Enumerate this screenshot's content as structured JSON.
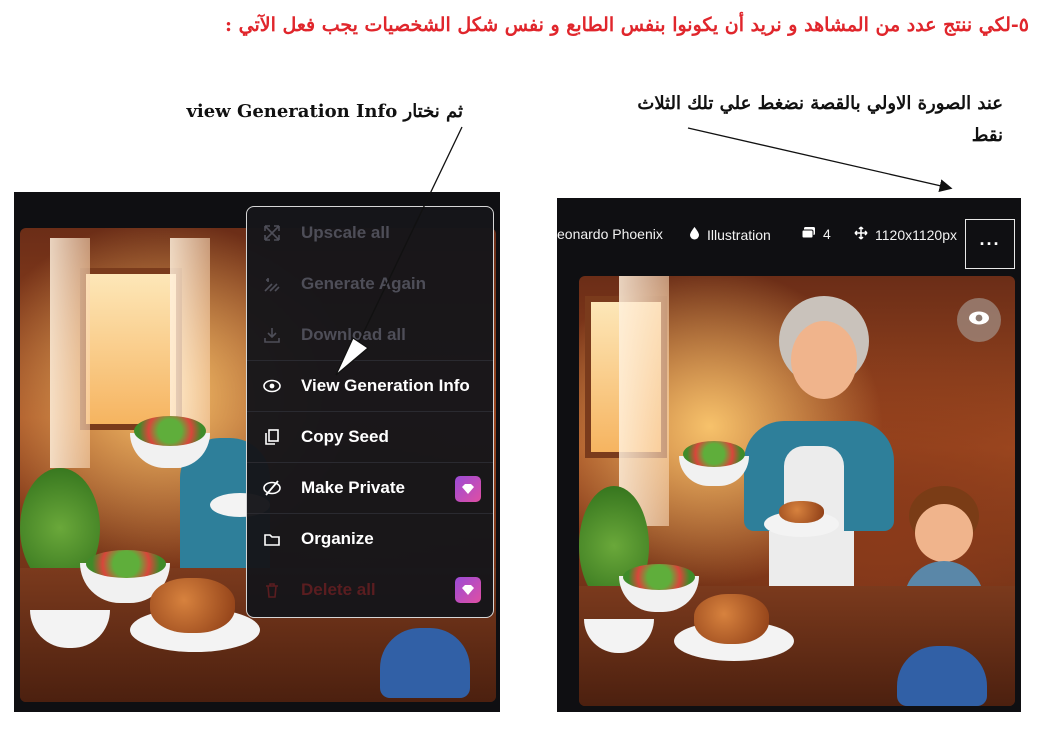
{
  "heading": "٥-لكي ننتج عدد من المشاهد و نريد أن يكونوا بنفس الطابع و نفس شكل الشخصيات يجب فعل الآتي :",
  "note_right": "عند الصورة الاولي بالقصة نضغط علي تلك الثلاث نقط",
  "note_left": "ثم نختار view Generation Info",
  "menu": {
    "items": [
      {
        "label": "Upscale all",
        "icon": "upscale-icon",
        "state": "disabled"
      },
      {
        "label": "Generate Again",
        "icon": "generate-again-icon",
        "state": "disabled"
      },
      {
        "label": "Download all",
        "icon": "download-icon",
        "state": "disabled"
      },
      {
        "label": "View Generation Info",
        "icon": "eye-icon",
        "state": "enabled"
      },
      {
        "label": "Copy Seed",
        "icon": "copy-icon",
        "state": "enabled"
      },
      {
        "label": "Make Private",
        "icon": "eye-off-icon",
        "state": "enabled",
        "badge": "diamond-icon"
      },
      {
        "label": "Organize",
        "icon": "folder-icon",
        "state": "enabled"
      },
      {
        "label": "Delete all",
        "icon": "trash-icon",
        "state": "danger",
        "badge": "diamond-icon"
      }
    ]
  },
  "toolbar": {
    "model": "eonardo Phoenix",
    "style": "Illustration",
    "count": "4",
    "size": "1120x1120px",
    "more": "···"
  },
  "colors": {
    "heading": "#e0262c",
    "menu_bg": "#16161a",
    "badge": "#b24fc4"
  }
}
